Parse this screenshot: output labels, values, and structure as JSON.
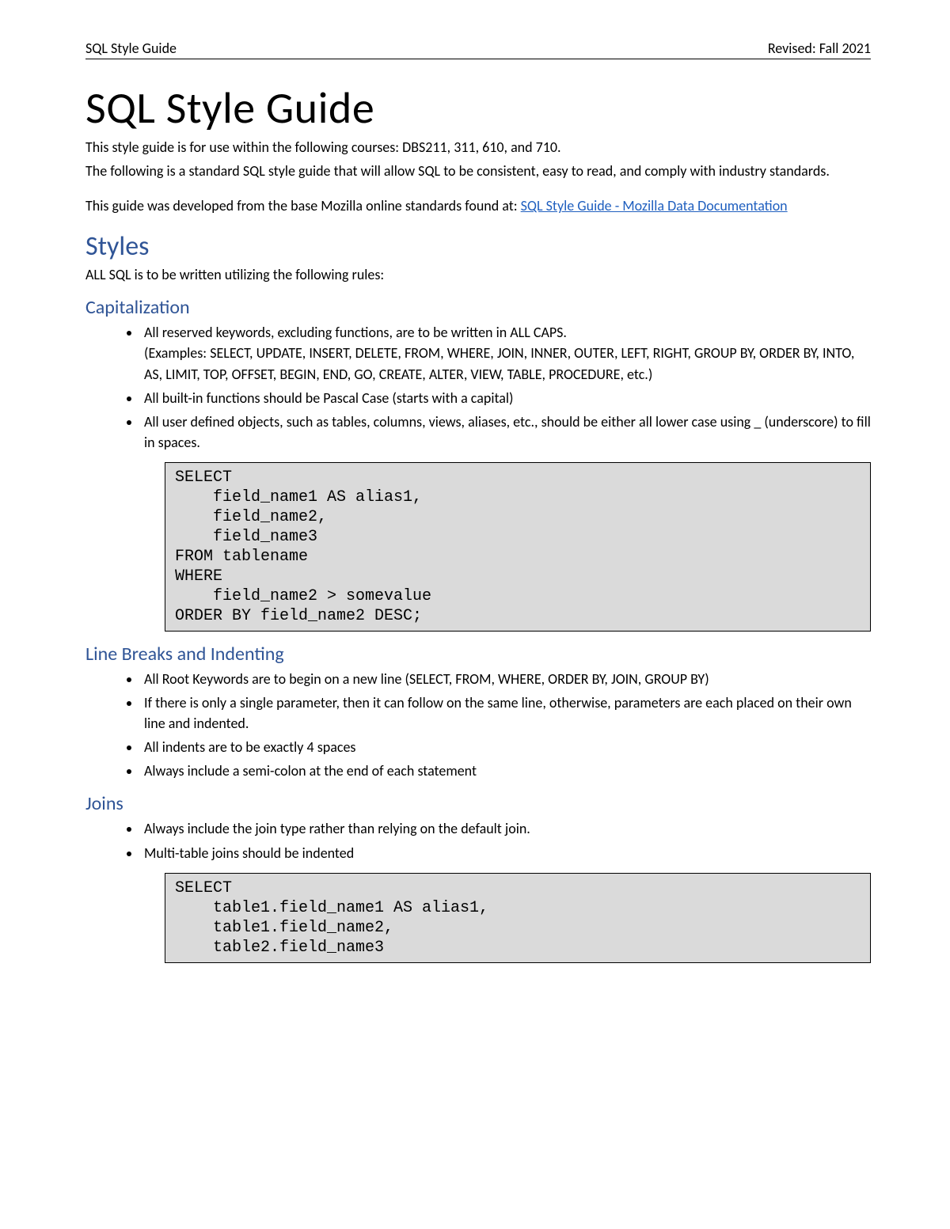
{
  "header": {
    "left": "SQL Style Guide",
    "right": "Revised: Fall 2021"
  },
  "title": "SQL Style Guide",
  "intro1": "This style guide is for use within the following courses: DBS211, 311, 610, and 710.",
  "intro2": "The following is a standard SQL style guide that will allow SQL to be consistent, easy to read, and comply with industry standards.",
  "intro3_prefix": "This guide was developed from the base Mozilla online standards found at: ",
  "intro3_link": "SQL Style Guide - Mozilla Data Documentation",
  "section_styles": "Styles",
  "styles_intro": "ALL SQL is to be written utilizing the following rules:",
  "sub_capitalization": "Capitalization",
  "cap_items": [
    "All reserved keywords, excluding functions, are to be written in ALL CAPS.\n(Examples: SELECT, UPDATE, INSERT, DELETE, FROM, WHERE, JOIN, INNER, OUTER, LEFT, RIGHT, GROUP BY, ORDER BY, INTO, AS, LIMIT, TOP, OFFSET, BEGIN, END, GO, CREATE, ALTER, VIEW, TABLE, PROCEDURE, etc.)",
    "All built-in functions should be Pascal Case (starts with a capital)",
    "All user defined objects, such as tables, columns, views, aliases, etc., should be either all lower case using _ (underscore) to fill in spaces."
  ],
  "code1": "SELECT\n    field_name1 AS alias1,\n    field_name2,\n    field_name3\nFROM tablename\nWHERE\n    field_name2 > somevalue\nORDER BY field_name2 DESC;",
  "sub_linebreaks": "Line Breaks and Indenting",
  "lb_items": [
    "All Root Keywords are to begin on a new line (SELECT, FROM, WHERE, ORDER BY, JOIN, GROUP BY)",
    "If there is only a single parameter, then it can follow on the same line, otherwise, parameters are each placed on their own line and indented.",
    "All indents are to be exactly 4 spaces",
    "Always include a semi-colon at the end of each statement"
  ],
  "sub_joins": "Joins",
  "joins_items": [
    "Always include the join type rather than relying on the default join.",
    "Multi-table joins should be indented"
  ],
  "code2": "SELECT\n    table1.field_name1 AS alias1,\n    table1.field_name2,\n    table2.field_name3"
}
